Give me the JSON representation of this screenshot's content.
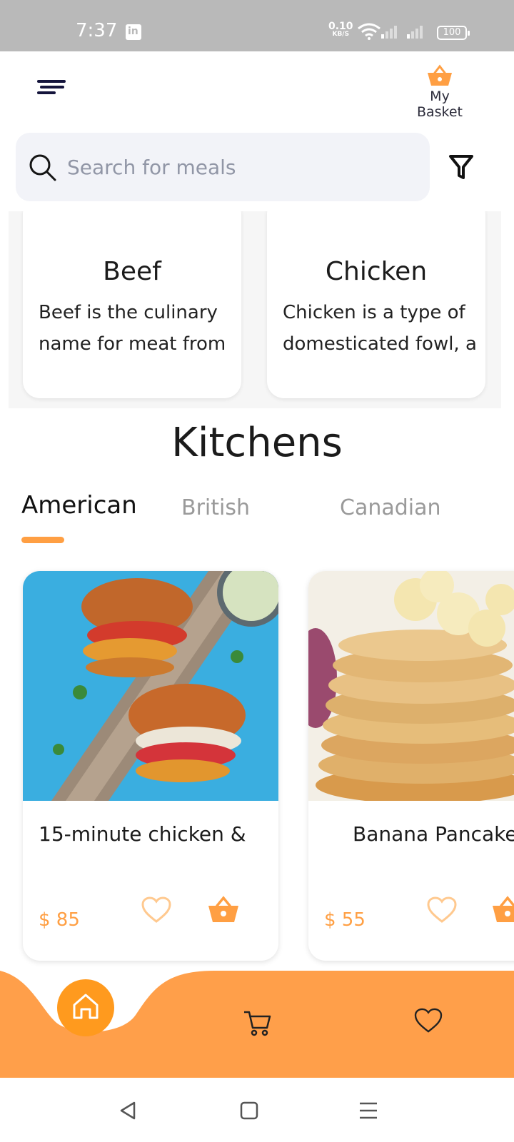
{
  "status_bar": {
    "time": "7:37",
    "net_speed_value": "0.10",
    "net_speed_unit": "KB/S",
    "battery": "100"
  },
  "header": {
    "basket_label": "My Basket"
  },
  "search": {
    "placeholder": "Search for meals"
  },
  "categories": [
    {
      "title": "Beef",
      "desc_line1": "Beef is the culinary",
      "desc_line2": "name for meat from"
    },
    {
      "title": "Chicken",
      "desc_line1": "Chicken is a type of",
      "desc_line2": "domesticated fowl, a"
    }
  ],
  "kitchens": {
    "title": "Kitchens",
    "tabs": [
      "American",
      "British",
      "Canadian"
    ],
    "active_tab": "American"
  },
  "meals": [
    {
      "name": "15-minute chicken &",
      "price": "$ 85"
    },
    {
      "name": "Banana Pancakes",
      "price": "$ 55"
    }
  ],
  "colors": {
    "accent": "#ff9f43",
    "home_button": "#ff9a1e",
    "nav_dark": "#14143c"
  },
  "icons": {
    "menu": "menu-icon",
    "basket": "basket-icon",
    "search": "search-icon",
    "filter": "filter-icon",
    "heart": "heart-icon",
    "home": "home-icon",
    "cart": "cart-icon"
  }
}
